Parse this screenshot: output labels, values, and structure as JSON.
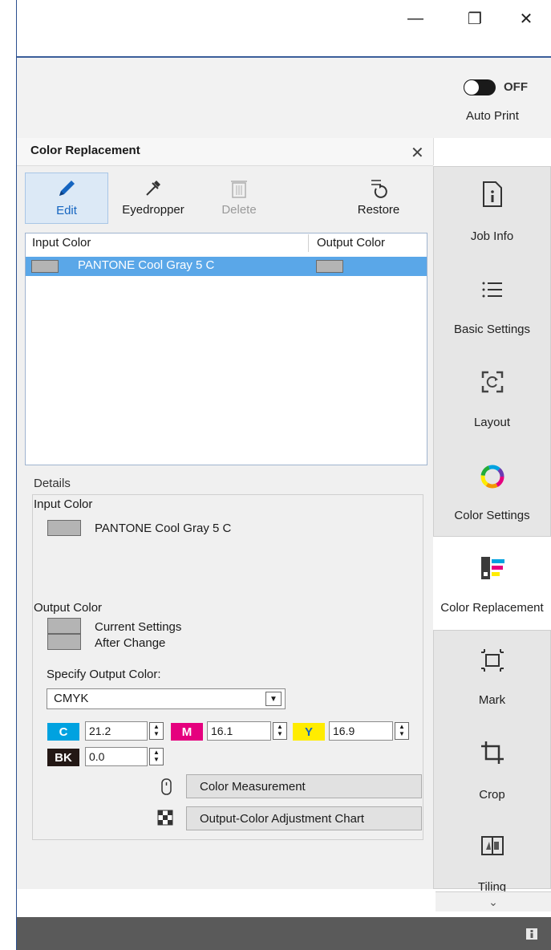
{
  "window": {
    "minimize": "—",
    "maximize": "❐",
    "close": "✕"
  },
  "top_bar": {
    "toggle_state": "OFF",
    "auto_print_label": "Auto Print"
  },
  "panel": {
    "title": "Color Replacement",
    "close": "✕",
    "toolbar": [
      {
        "label": "Edit",
        "icon": "pencil-icon"
      },
      {
        "label": "Eyedropper",
        "icon": "eyedropper-icon"
      },
      {
        "label": "Delete",
        "icon": "trash-icon"
      },
      {
        "label": "Restore",
        "icon": "restore-icon"
      }
    ],
    "list": {
      "columns": [
        "Input Color",
        "Output Color"
      ],
      "rows": [
        {
          "input_color": "PANTONE Cool Gray 5 C"
        }
      ]
    },
    "details": {
      "label": "Details",
      "input_color_label": "Input Color",
      "input_color_value": "PANTONE Cool Gray 5 C",
      "output_color_label": "Output Color",
      "current_settings": "Current Settings",
      "after_change": "After Change",
      "specify_label": "Specify Output Color:",
      "color_mode": "CMYK",
      "channels": {
        "c": {
          "label": "C",
          "value": "21.2",
          "color": "#00a2e0"
        },
        "m": {
          "label": "M",
          "value": "16.1",
          "color": "#e5007e"
        },
        "y": {
          "label": "Y",
          "value": "16.9",
          "color": "#ffec00"
        },
        "bk": {
          "label": "BK",
          "value": "0.0",
          "color": "#231815"
        }
      },
      "color_measurement_button": "Color Measurement",
      "adjustment_chart_button": "Output-Color Adjustment Chart"
    }
  },
  "swatch_color": "#b4b4b4",
  "selection_color": "#5aa7e8",
  "nav": {
    "items": [
      {
        "label": "Job Info",
        "icon": "info-document-icon"
      },
      {
        "label": "Basic Settings",
        "icon": "list-icon"
      },
      {
        "label": "Layout",
        "icon": "layout-icon"
      },
      {
        "label": "Color Settings",
        "icon": "color-wheel-icon"
      },
      {
        "label": "Color Replacement",
        "icon": "color-replacement-icon"
      },
      {
        "label": "Mark",
        "icon": "crop-marks-icon"
      },
      {
        "label": "Crop",
        "icon": "crop-icon"
      },
      {
        "label": "Tiling",
        "icon": "tiling-icon"
      }
    ],
    "scroll_down": "⌄"
  }
}
